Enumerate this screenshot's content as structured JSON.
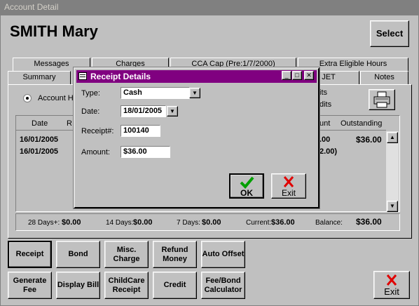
{
  "window": {
    "title": "Account Detail"
  },
  "client": {
    "name": "SMITH Mary"
  },
  "select_label": "Select",
  "tabs": {
    "row1": [
      "Messages",
      "Charges",
      "CCA Cap (Pre:1/7/2000)",
      "Extra Eligible Hours"
    ],
    "row2": [
      "Summary",
      "JET",
      "Notes"
    ]
  },
  "account": {
    "radio_label": "Account H",
    "right1": "its",
    "right2": "dits"
  },
  "list": {
    "headers": {
      "date": "Date",
      "r": "R",
      "unt": "unt",
      "outstanding": "Outstanding"
    },
    "rows": [
      {
        "date": "16/01/2005",
        "amount_fragment": ".00",
        "outstanding": "$36.00"
      },
      {
        "date": "16/01/2005",
        "amount_fragment": "2.00)",
        "outstanding": ""
      }
    ]
  },
  "totals": {
    "d28_label": "28 Days+:",
    "d28": "$0.00",
    "d14_label": "14 Days:",
    "d14": "$0.00",
    "d7_label": "7 Days:",
    "d7": "$0.00",
    "current_label": "Current:",
    "current": "$36.00",
    "balance_label": "Balance:",
    "balance": "$36.00"
  },
  "buttons": {
    "receipt": "Receipt",
    "bond": "Bond",
    "misc_charge": "Misc. Charge",
    "refund_money": "Refund Money",
    "auto_offset": "Auto Offset",
    "generate_fee": "Generate Fee",
    "display_bill": "Display Bill",
    "childcare_receipt": "ChildCare Receipt",
    "credit": "Credit",
    "fee_bond_calculator": "Fee/Bond Calculator",
    "exit": "Exit"
  },
  "dialog": {
    "title": "Receipt Details",
    "type_label": "Type:",
    "type_value": "Cash",
    "date_label": "Date:",
    "date_value": "18/01/2005",
    "receipt_label": "Receipt#:",
    "receipt_value": "100140",
    "amount_label": "Amount:",
    "amount_value": "$36.00",
    "ok": "OK",
    "exit": "Exit"
  },
  "colors": {
    "dialog_title": "#800080",
    "ok_check": "#00a000",
    "exit_x": "#e00000"
  }
}
